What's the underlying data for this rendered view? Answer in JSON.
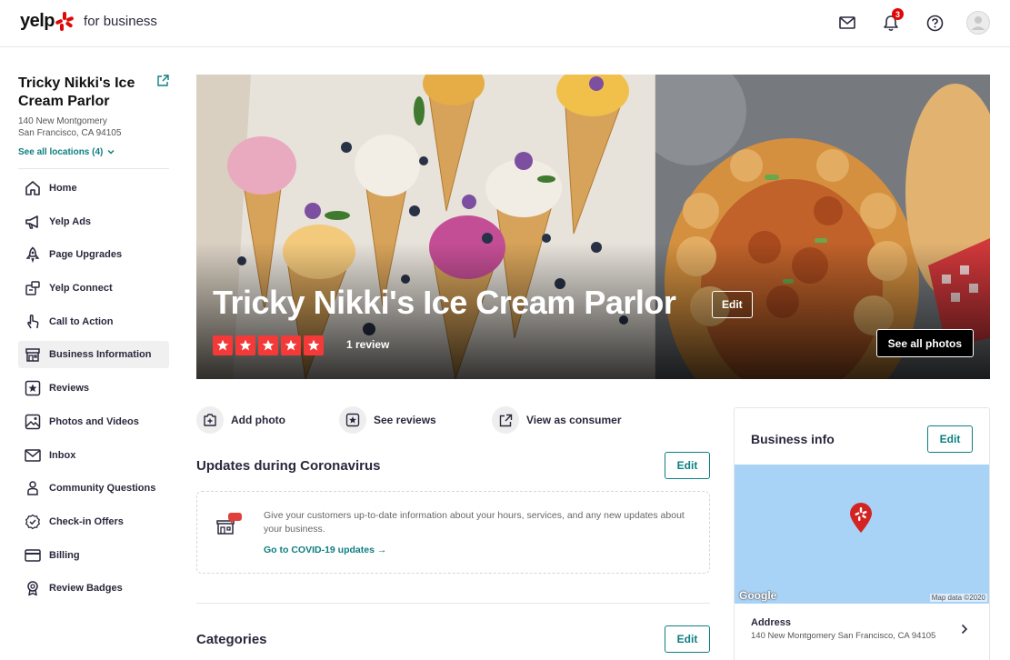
{
  "header": {
    "brand": "yelp",
    "brand_sub": "for business",
    "notification_count": "3",
    "icons": [
      "mail-icon",
      "bell-icon",
      "help-icon",
      "avatar"
    ]
  },
  "sidebar": {
    "business_name": "Tricky Nikki's Ice Cream Parlor",
    "address_line1": "140 New Montgomery",
    "address_line2": "San Francisco, CA 94105",
    "see_locations": "See all locations (4)",
    "items": [
      {
        "label": "Home",
        "icon": "home-icon"
      },
      {
        "label": "Yelp Ads",
        "icon": "megaphone-icon"
      },
      {
        "label": "Page Upgrades",
        "icon": "rocket-icon"
      },
      {
        "label": "Yelp Connect",
        "icon": "connect-icon"
      },
      {
        "label": "Call to Action",
        "icon": "hand-pointer-icon"
      },
      {
        "label": "Business Information",
        "icon": "storefront-icon",
        "active": true
      },
      {
        "label": "Reviews",
        "icon": "review-star-icon"
      },
      {
        "label": "Photos and Videos",
        "icon": "photo-icon"
      },
      {
        "label": "Inbox",
        "icon": "mail-icon"
      },
      {
        "label": "Community Questions",
        "icon": "community-icon"
      },
      {
        "label": "Check-in Offers",
        "icon": "badge-check-icon"
      },
      {
        "label": "Billing",
        "icon": "credit-card-icon"
      },
      {
        "label": "Review Badges",
        "icon": "award-icon"
      }
    ]
  },
  "hero": {
    "title": "Tricky Nikki's Ice Cream Parlor",
    "edit_label": "Edit",
    "rating": 5,
    "review_count": "1 review",
    "see_photos_label": "See all photos"
  },
  "actions": [
    {
      "label": "Add photo",
      "icon": "add-photo-icon"
    },
    {
      "label": "See reviews",
      "icon": "review-star-icon"
    },
    {
      "label": "View as consumer",
      "icon": "external-link-icon"
    }
  ],
  "updates": {
    "title": "Updates during Coronavirus",
    "edit_label": "Edit",
    "body": "Give your customers up-to-date information about your hours, services, and any new updates about your business.",
    "link": "Go to COVID-19 updates →"
  },
  "categories": {
    "title": "Categories",
    "edit_label": "Edit"
  },
  "business_info": {
    "title": "Business info",
    "edit_label": "Edit",
    "map_logo": "Google",
    "map_attribution": "Map data ©2020",
    "address_label": "Address",
    "address_value": "140 New Montgomery San Francisco, CA 94105"
  },
  "colors": {
    "brand_red": "#e00707",
    "accent_teal": "#0e7e82",
    "star_red": "#f43939",
    "map_blue": "#a9d3f6"
  }
}
